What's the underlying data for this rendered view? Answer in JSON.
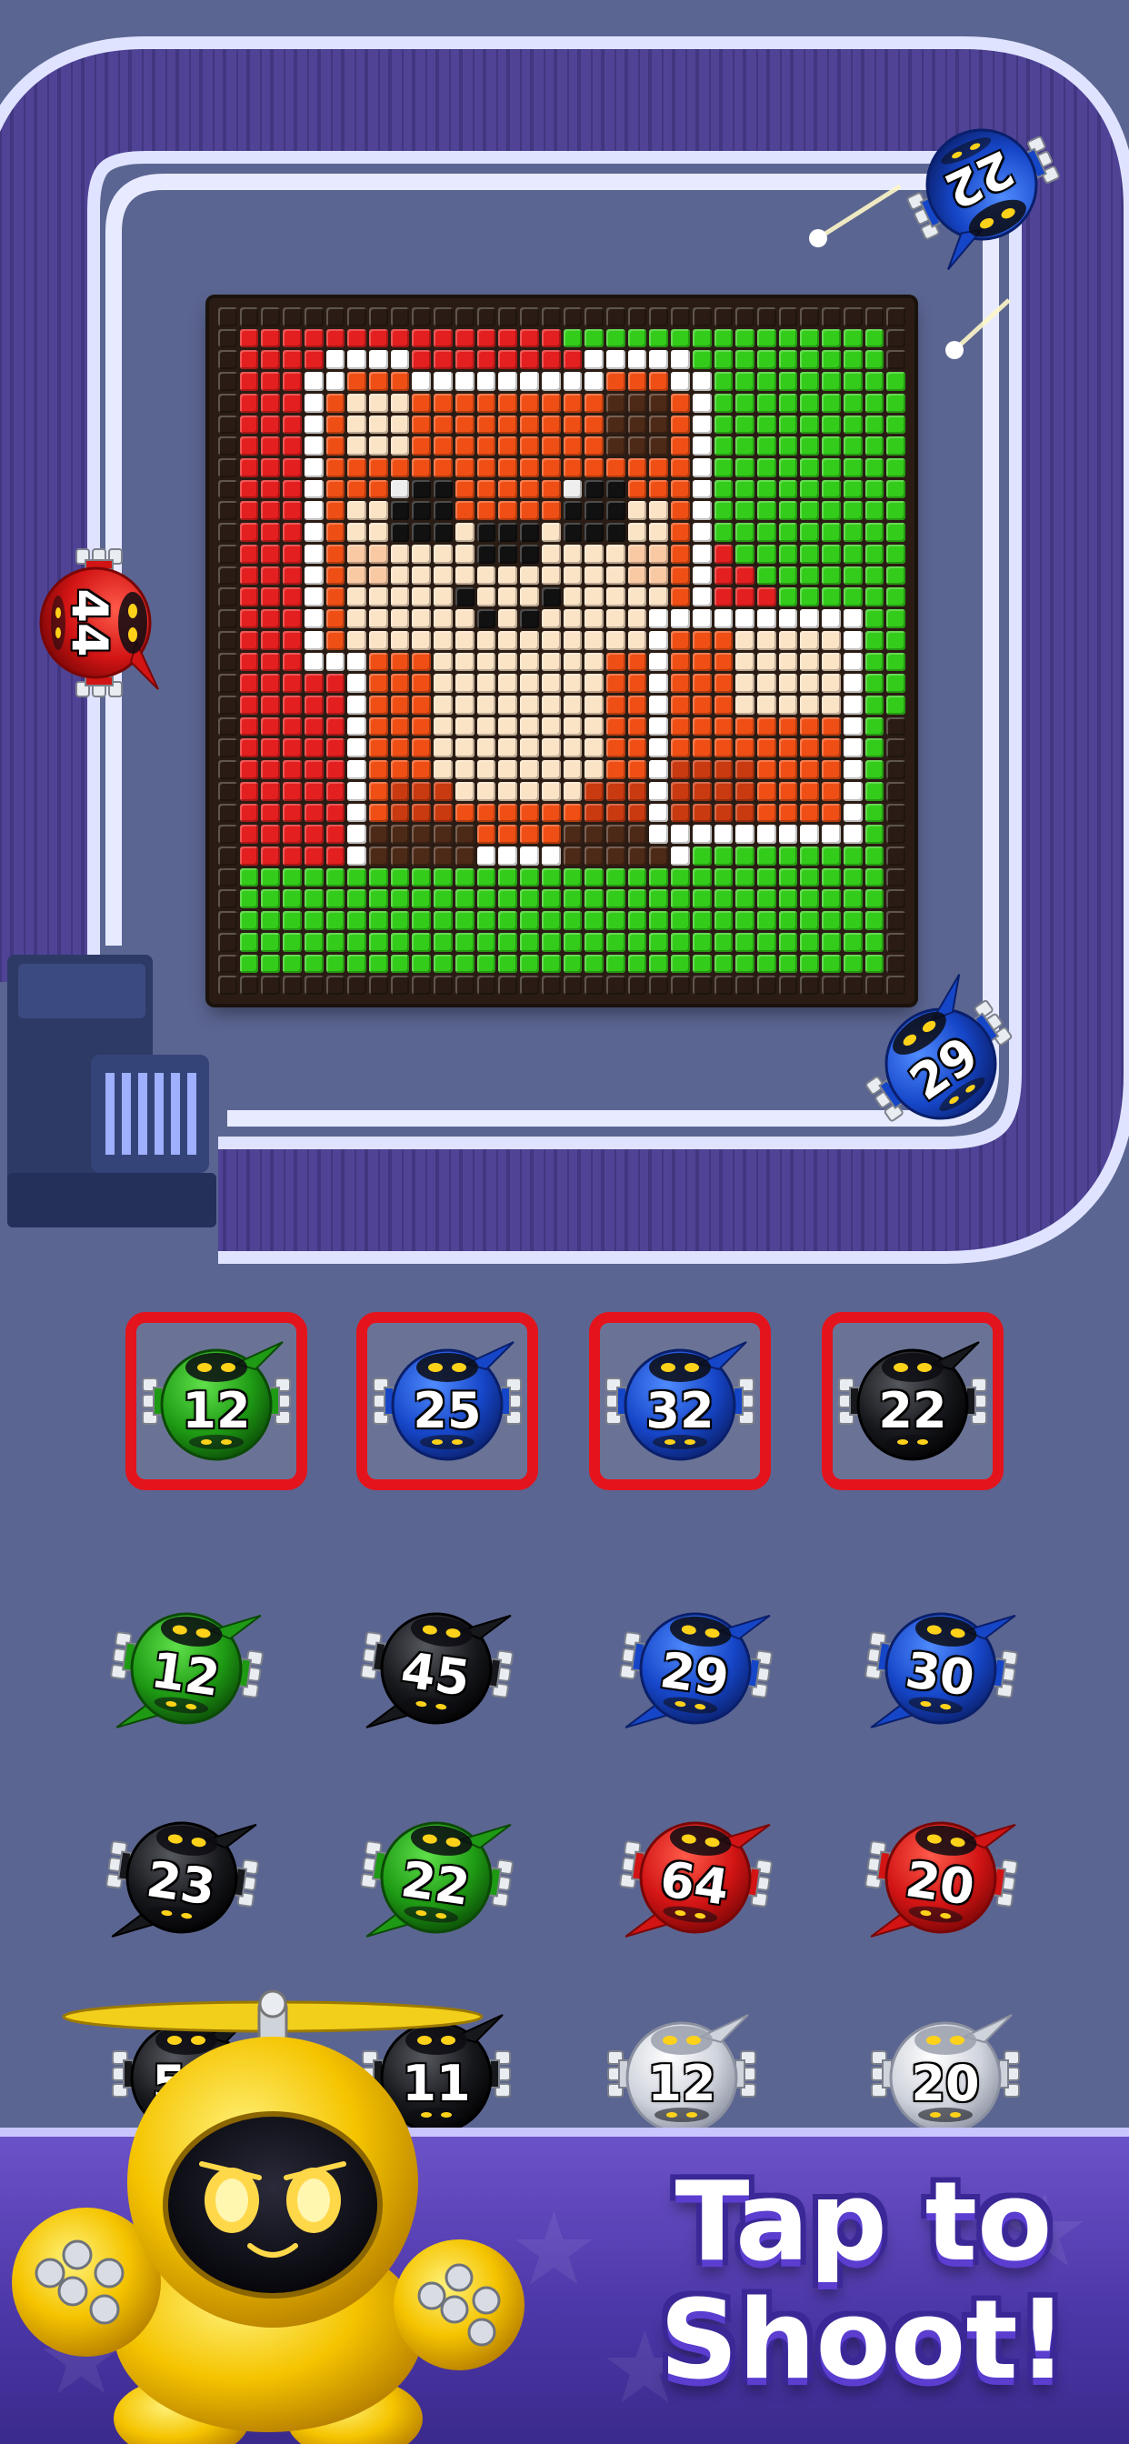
{
  "board": {
    "palette": {
      "K": "#2a1c14",
      "R": "#e31f1f",
      "G": "#33cc1a",
      "W": "#ffffff",
      "O": "#ef4f15",
      "o": "#c93a10",
      "C": "#fbe3c6",
      "P": "#f9c9a4",
      "B": "#4d2a17",
      "E": "#111111",
      "H": "#eeeeee"
    }
  },
  "conveyor": {
    "robots": [
      {
        "id": "track-robot-22",
        "color": "blue",
        "value": "22"
      },
      {
        "id": "track-robot-44",
        "color": "red",
        "value": "44"
      },
      {
        "id": "track-robot-29",
        "color": "blue",
        "value": "29"
      }
    ]
  },
  "queue_slots": [
    {
      "color": "green",
      "value": "12"
    },
    {
      "color": "blue",
      "value": "25"
    },
    {
      "color": "blue",
      "value": "32"
    },
    {
      "color": "black",
      "value": "22"
    }
  ],
  "reserve": [
    [
      {
        "color": "green",
        "value": "12"
      },
      {
        "color": "black",
        "value": "45"
      },
      {
        "color": "blue",
        "value": "29"
      },
      {
        "color": "blue",
        "value": "30"
      }
    ],
    [
      {
        "color": "black",
        "value": "23"
      },
      {
        "color": "green",
        "value": "22"
      },
      {
        "color": "red",
        "value": "64"
      },
      {
        "color": "red",
        "value": "20"
      }
    ],
    [
      {
        "color": "black",
        "value": "58"
      },
      {
        "color": "black",
        "value": "11"
      },
      {
        "color": "silver",
        "value": "12"
      },
      {
        "color": "silver",
        "value": "20"
      }
    ]
  ],
  "colors": {
    "red": [
      "#ff5a4a",
      "#d21414",
      "#7a0606"
    ],
    "blue": [
      "#4f8bff",
      "#1646c8",
      "#0a1f6b"
    ],
    "green": [
      "#5fe04a",
      "#1e9a14",
      "#0b4a06"
    ],
    "black": [
      "#55585e",
      "#17181c",
      "#000000"
    ],
    "silver": [
      "#ffffff",
      "#cfd3dc",
      "#8b90a0"
    ]
  },
  "cta": {
    "line1": "Tap to",
    "line2": "Shoot!"
  }
}
